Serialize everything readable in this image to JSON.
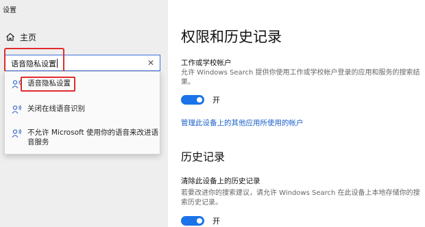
{
  "window": {
    "title": "设置"
  },
  "sidebar": {
    "home_label": "主页",
    "search": {
      "value": "语音隐私设置",
      "clear_label": "✕"
    },
    "suggestions": [
      {
        "label": "语音隐私设置",
        "icon": "voice-settings-icon"
      },
      {
        "label": "关闭在线语音识别",
        "icon": "voice-settings-icon"
      },
      {
        "label": "不允许 Microsoft 使用你的语音来改进语音服务",
        "icon": "voice-settings-icon"
      }
    ]
  },
  "main": {
    "title": "权限和历史记录",
    "work_accounts": {
      "heading": "工作或学校帐户",
      "description": "允许 Windows Search 提供你使用工作或学校帐户登录的应用和服务的搜索结果。",
      "toggle_label": "开"
    },
    "manage_link": "管理此设备上的其他应用所使用的帐户",
    "history": {
      "title": "历史记录",
      "heading": "清除此设备上的历史记录",
      "description": "若要改进你的搜索建议，请允许 Windows Search 在此设备上本地存储你的搜索历史记录。",
      "toggle_label": "开"
    }
  },
  "colors": {
    "accent": "#1a73e8",
    "highlight": "#e12b2b",
    "link": "#1a5fc9"
  }
}
